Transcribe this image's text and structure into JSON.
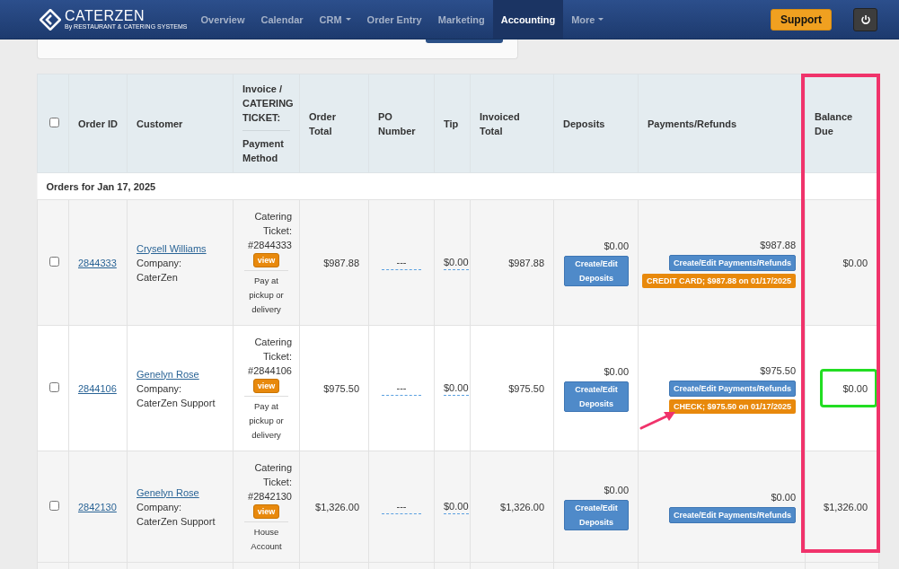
{
  "nav": {
    "logo": "CATERZEN",
    "tagline": "By RESTAURANT & CATERING SYSTEMS",
    "items": [
      {
        "label": "Overview",
        "selected": false,
        "dropdown": false
      },
      {
        "label": "Calendar",
        "selected": false,
        "dropdown": false
      },
      {
        "label": "CRM",
        "selected": false,
        "dropdown": true
      },
      {
        "label": "Order Entry",
        "selected": false,
        "dropdown": false
      },
      {
        "label": "Marketing",
        "selected": false,
        "dropdown": false
      },
      {
        "label": "Accounting",
        "selected": true,
        "dropdown": false
      },
      {
        "label": "More",
        "selected": false,
        "dropdown": true
      }
    ],
    "support": "Support"
  },
  "table": {
    "select_all": {
      "checked": false
    },
    "columns": [
      {
        "label": "Order ID",
        "highlighted": false
      },
      {
        "label": "Customer",
        "highlighted": false
      },
      {
        "label": "Invoice / CATERING TICKET:",
        "sublabel": "Payment Method",
        "highlighted": false
      },
      {
        "label": "Order Total",
        "highlighted": false
      },
      {
        "label": "PO Number",
        "highlighted": false
      },
      {
        "label": "Tip",
        "highlighted": false
      },
      {
        "label": "Invoiced Total",
        "highlighted": false
      },
      {
        "label": "Deposits",
        "highlighted": false
      },
      {
        "label": "Payments/Refunds",
        "highlighted": false
      },
      {
        "label": "Balance Due",
        "highlighted": true
      }
    ],
    "group": "Orders for Jan 17, 2025",
    "rows": [
      {
        "checked": false,
        "order_id": "2844333",
        "customer": "Crysell Williams",
        "company": "Company: CaterZen",
        "ticket": "Catering Ticket: #2844333",
        "view": "view",
        "payment_method": "Pay at pickup or delivery",
        "order_total": "$987.88",
        "po": "---",
        "tip": "$0.00",
        "invoiced_total": "$987.88",
        "deposits": "$0.00",
        "deposits_button": "Create/Edit Deposits",
        "payments": "$987.88",
        "payments_button": "Create/Edit Payments/Refunds",
        "badges": [
          {
            "label": "CREDIT CARD; $987.88 on 01/17/2025",
            "arrow": false
          }
        ],
        "balance_due": "$0.00",
        "highlighted": false
      },
      {
        "checked": false,
        "order_id": "2844106",
        "customer": "Genelyn Rose",
        "company": "Company: CaterZen Support",
        "ticket": "Catering Ticket: #2844106",
        "view": "view",
        "payment_method": "Pay at pickup or delivery",
        "order_total": "$975.50",
        "po": "---",
        "tip": "$0.00",
        "invoiced_total": "$975.50",
        "deposits": "$0.00",
        "deposits_button": "Create/Edit Deposits",
        "payments": "$975.50",
        "payments_button": "Create/Edit Payments/Refunds",
        "badges": [
          {
            "label": "CHECK; $975.50 on 01/17/2025",
            "arrow": true
          }
        ],
        "balance_due": "$0.00",
        "highlighted": true
      },
      {
        "checked": false,
        "order_id": "2842130",
        "customer": "Genelyn Rose",
        "company": "Company: CaterZen Support",
        "ticket": "Catering Ticket: #2842130",
        "view": "view",
        "payment_method": "House Account",
        "order_total": "$1,326.00",
        "po": "---",
        "tip": "$0.00",
        "invoiced_total": "$1,326.00",
        "deposits": "$0.00",
        "deposits_button": "Create/Edit Deposits",
        "payments": "$0.00",
        "payments_button": "Create/Edit Payments/Refunds",
        "badges": [],
        "balance_due": "$1,326.00",
        "highlighted": false
      }
    ]
  }
}
